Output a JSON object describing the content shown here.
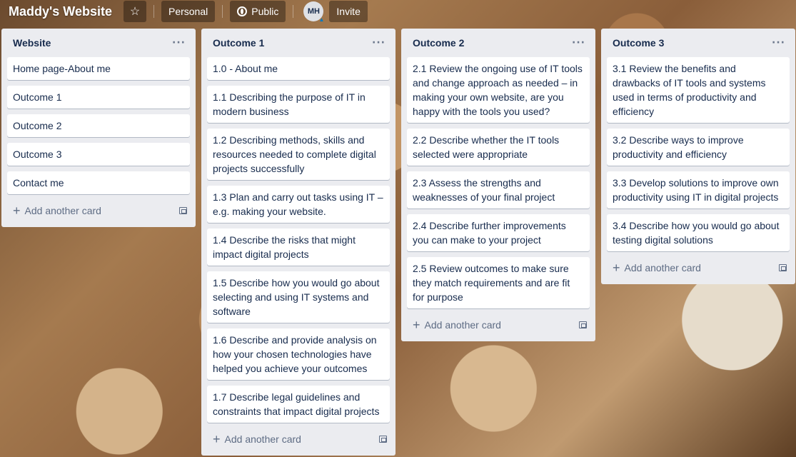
{
  "header": {
    "board_title": "Maddy's Website",
    "personal_label": "Personal",
    "public_label": "Public",
    "avatar_initials": "MH",
    "invite_label": "Invite"
  },
  "lists": [
    {
      "title": "Website",
      "cards": [
        "Home page-About me",
        "Outcome 1",
        "Outcome 2",
        "Outcome 3",
        "Contact me"
      ],
      "add_label": "Add another card"
    },
    {
      "title": "Outcome 1",
      "cards": [
        "1.0 - About me",
        "1.1 Describing the purpose of IT in modern business",
        "1.2 Describing methods, skills and resources needed to complete digital projects successfully",
        "1.3 Plan and carry out tasks using IT – e.g. making your website.",
        "1.4 Describe the risks that might impact digital projects",
        "1.5 Describe how you would go about selecting and using IT systems and software",
        "1.6 Describe and provide analysis on how your chosen technologies have helped you achieve your outcomes",
        "1.7 Describe legal guidelines and constraints that impact digital projects"
      ],
      "add_label": "Add another card"
    },
    {
      "title": "Outcome 2",
      "cards": [
        "2.1 Review the ongoing use of IT tools and change approach as needed – in making your own website, are you happy with the tools you used?",
        "2.2 Describe whether the IT tools selected were appropriate",
        "2.3 Assess the strengths and weaknesses of your final project",
        "2.4 Describe further improvements you can make to your project",
        "2.5 Review outcomes to make sure they match requirements and are fit for purpose"
      ],
      "add_label": "Add another card"
    },
    {
      "title": "Outcome 3",
      "cards": [
        "3.1 Review the benefits and drawbacks of IT tools and systems used in terms of productivity and efficiency",
        "3.2 Describe ways to improve productivity and efficiency",
        "3.3 Develop solutions to improve own productivity using IT in digital projects",
        "3.4 Describe how you would go about testing digital solutions"
      ],
      "add_label": "Add another card"
    }
  ]
}
